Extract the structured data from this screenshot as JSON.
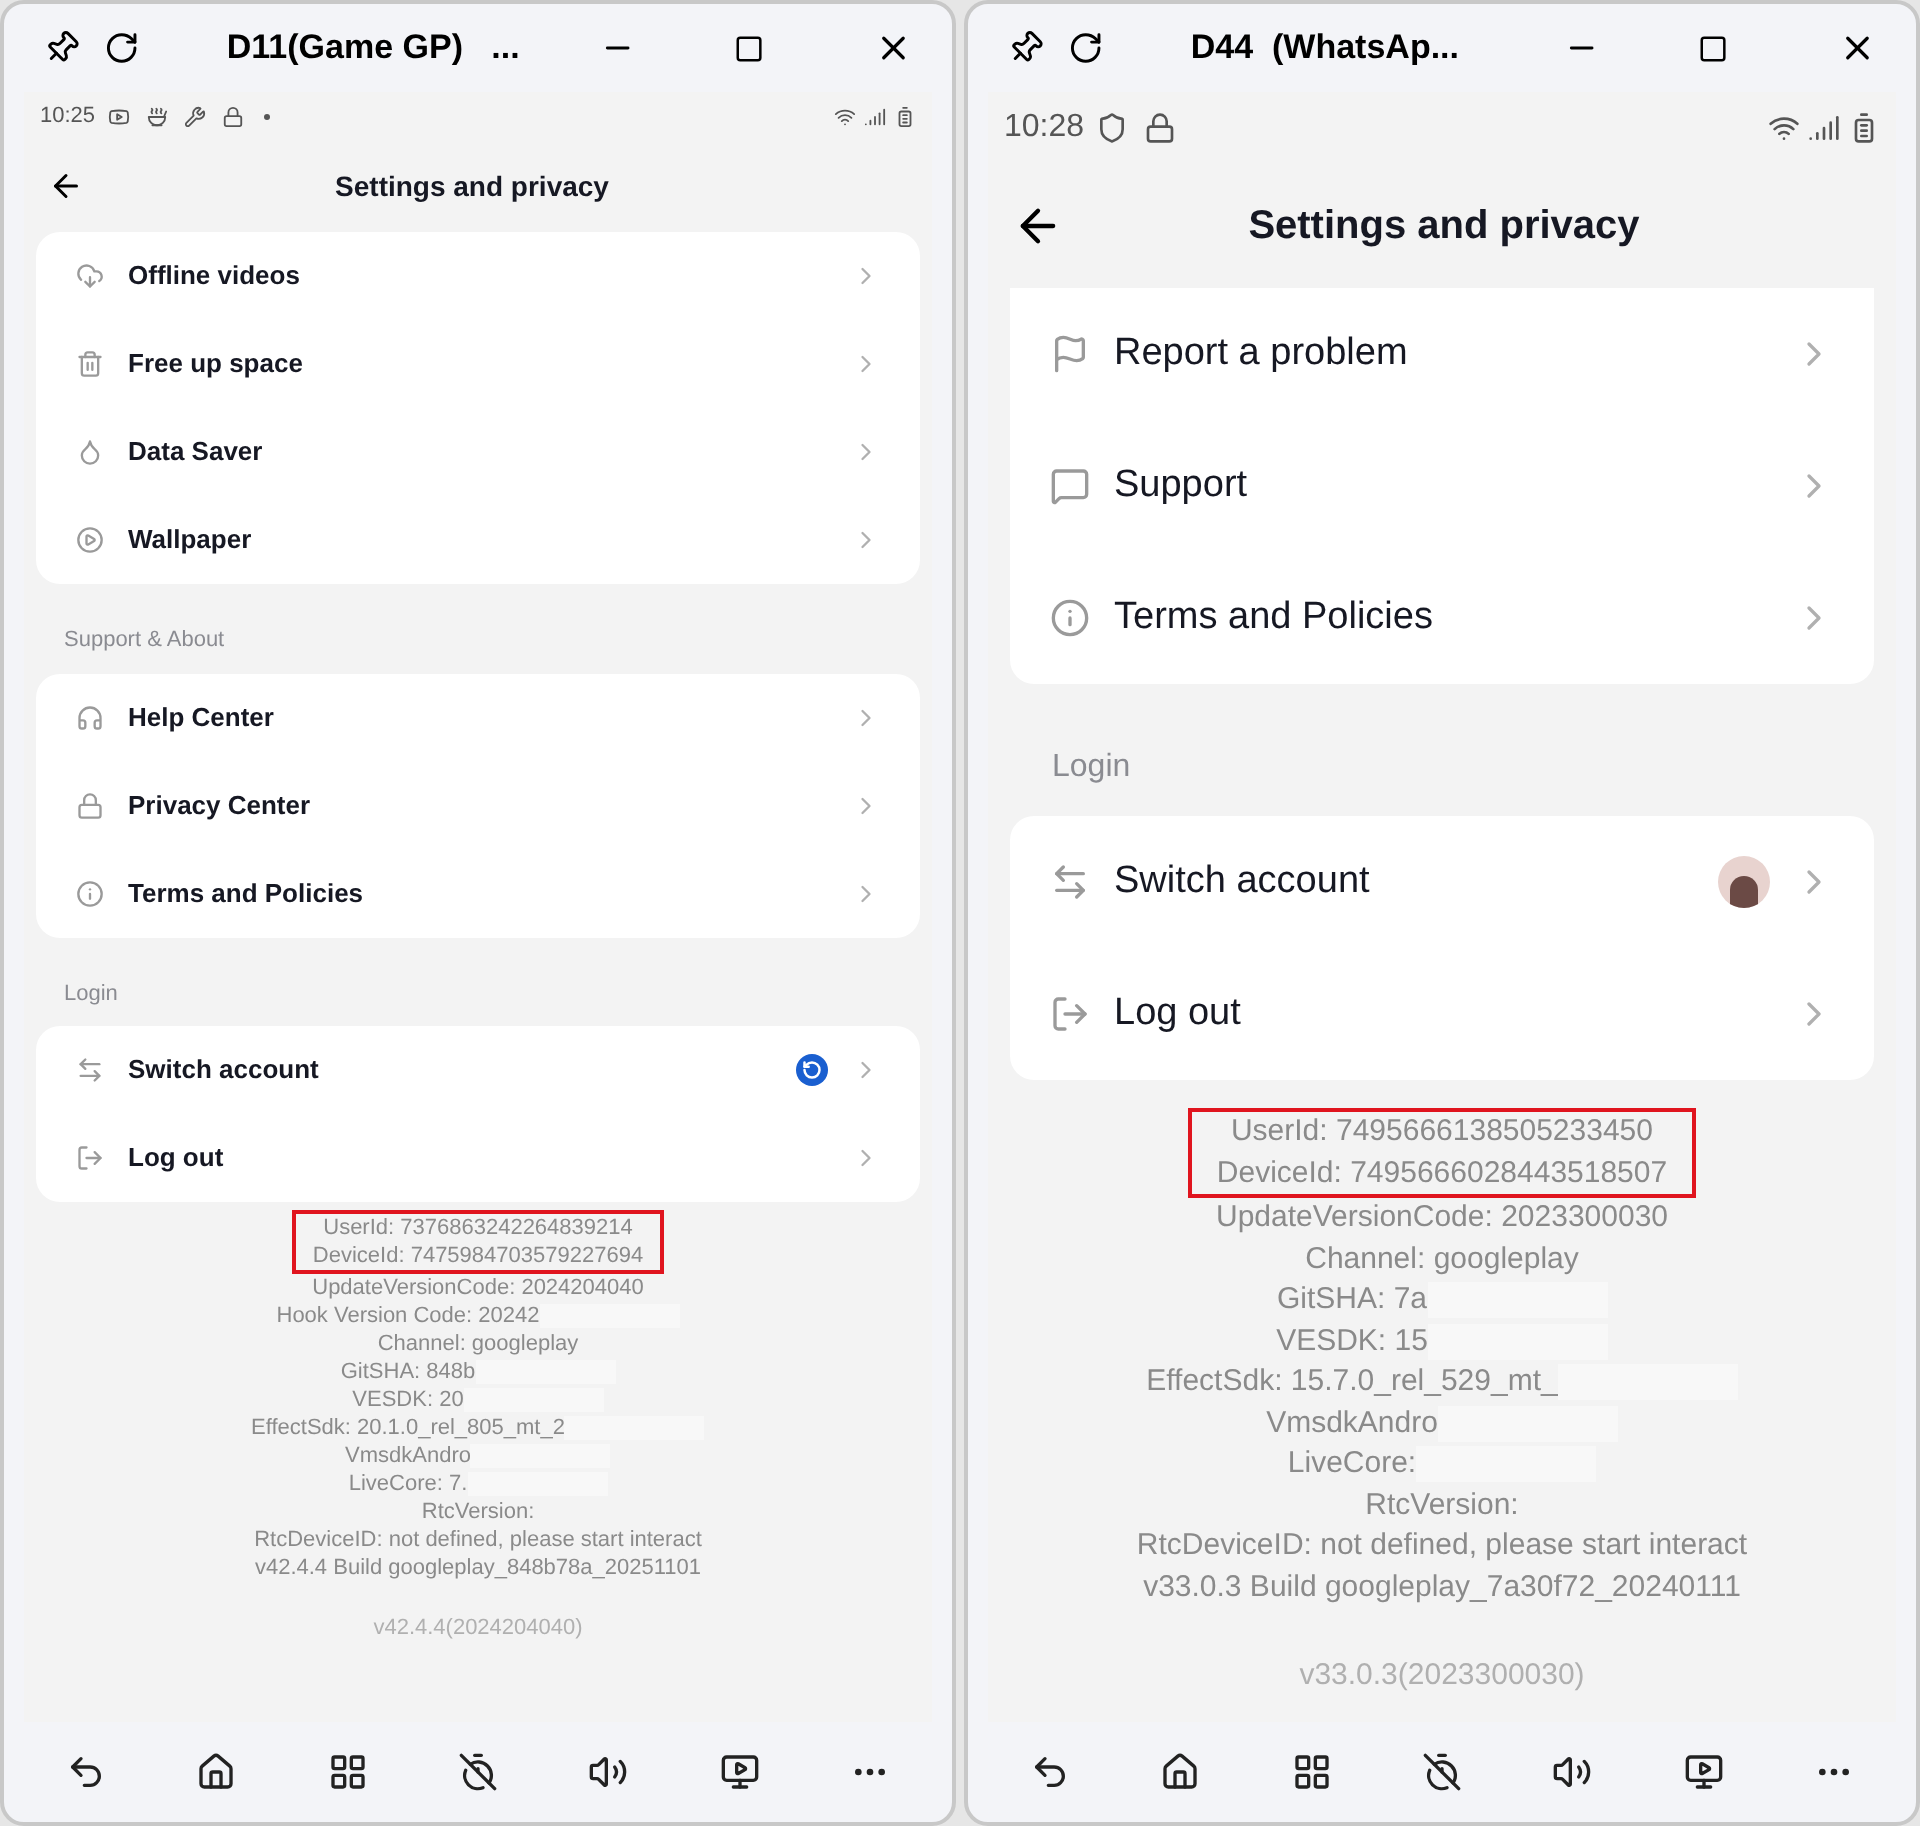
{
  "windows": [
    {
      "title": "D11(Game GP)   ...",
      "status_bar": {
        "time": "10:25",
        "icons": [
          {
            "kind": "video"
          },
          {
            "kind": "bowl"
          },
          {
            "kind": "wrench"
          },
          {
            "kind": "keyhole"
          },
          {
            "kind": "dot"
          }
        ]
      },
      "header": {
        "title": "Settings and privacy"
      },
      "sections": [
        {
          "items": [
            {
              "label": "Offline videos",
              "kind": "cloud"
            },
            {
              "label": "Free up space",
              "kind": "trash"
            },
            {
              "label": "Data Saver",
              "kind": "drop"
            },
            {
              "label": "Wallpaper",
              "kind": "play"
            }
          ]
        },
        {
          "label": "Support & About",
          "items": [
            {
              "label": "Help Center",
              "kind": "headphones"
            },
            {
              "label": "Privacy Center",
              "kind": "lock"
            },
            {
              "label": "Terms and Policies",
              "kind": "info"
            }
          ]
        },
        {
          "label": "Login",
          "items": [
            {
              "label": "Switch account",
              "kind": "switch",
              "accessory": {
                "kind": "badge"
              }
            },
            {
              "label": "Log out",
              "kind": "logout"
            }
          ]
        }
      ],
      "info": [
        {
          "text": "UserId: 7376863242264839214",
          "highlighted": true
        },
        {
          "text": "DeviceId: 7475984703579227694",
          "highlighted": true
        },
        {
          "text": "UpdateVersionCode: 2024204040",
          "highlighted": false
        },
        {
          "text": "Hook Version Code: 20242",
          "highlighted": false,
          "masked": true
        },
        {
          "text": "Channel: googleplay",
          "highlighted": false
        },
        {
          "text": "GitSHA: 848b",
          "highlighted": false,
          "masked": true
        },
        {
          "text": "VESDK: 20",
          "highlighted": false,
          "masked": true
        },
        {
          "text": "EffectSdk: 20.1.0_rel_805_mt_2",
          "highlighted": false,
          "masked": true
        },
        {
          "text": "VmsdkAndro",
          "highlighted": false,
          "masked": true
        },
        {
          "text": "LiveCore: 7.",
          "highlighted": false,
          "masked": true
        },
        {
          "text": "RtcVersion:",
          "highlighted": false
        },
        {
          "text": "RtcDeviceID: not defined, please start interact",
          "highlighted": false
        },
        {
          "text": "v42.4.4 Build googleplay_848b78a_20251101",
          "highlighted": false
        }
      ],
      "version": "v42.4.4(2024204040)"
    },
    {
      "title": "D44  (WhatsAp...",
      "status_bar": {
        "time": "10:28",
        "icons": [
          {
            "kind": "shield"
          },
          {
            "kind": "keyhole"
          }
        ]
      },
      "header": {
        "title": "Settings and privacy"
      },
      "sections": [
        {
          "items": [
            {
              "label": "Report a problem",
              "kind": "flag"
            },
            {
              "label": "Support",
              "kind": "message"
            },
            {
              "label": "Terms and Policies",
              "kind": "info"
            }
          ]
        },
        {
          "label": "Login",
          "items": [
            {
              "label": "Switch account",
              "kind": "switch",
              "accessory": {
                "kind": "avatar"
              }
            },
            {
              "label": "Log out",
              "kind": "logout"
            }
          ]
        }
      ],
      "info": [
        {
          "text": "UserId: 7495666138505233450",
          "highlighted": true
        },
        {
          "text": "DeviceId: 7495666028443518507",
          "highlighted": true
        },
        {
          "text": "UpdateVersionCode: 2023300030",
          "highlighted": false
        },
        {
          "text": "Channel: googleplay",
          "highlighted": false
        },
        {
          "text": "GitSHA: 7a",
          "highlighted": false,
          "masked": true
        },
        {
          "text": "VESDK: 15",
          "highlighted": false,
          "masked": true
        },
        {
          "text": "EffectSdk: 15.7.0_rel_529_mt_",
          "highlighted": false,
          "masked": true
        },
        {
          "text": "VmsdkAndro",
          "highlighted": false,
          "masked": true
        },
        {
          "text": "LiveCore:",
          "highlighted": false,
          "masked": true
        },
        {
          "text": "RtcVersion:",
          "highlighted": false
        },
        {
          "text": "RtcDeviceID: not defined, please start interact",
          "highlighted": false
        },
        {
          "text": "v33.0.3 Build googleplay_7a30f72_20240111",
          "highlighted": false
        }
      ],
      "version": "v33.0.3(2023300030)"
    }
  ]
}
